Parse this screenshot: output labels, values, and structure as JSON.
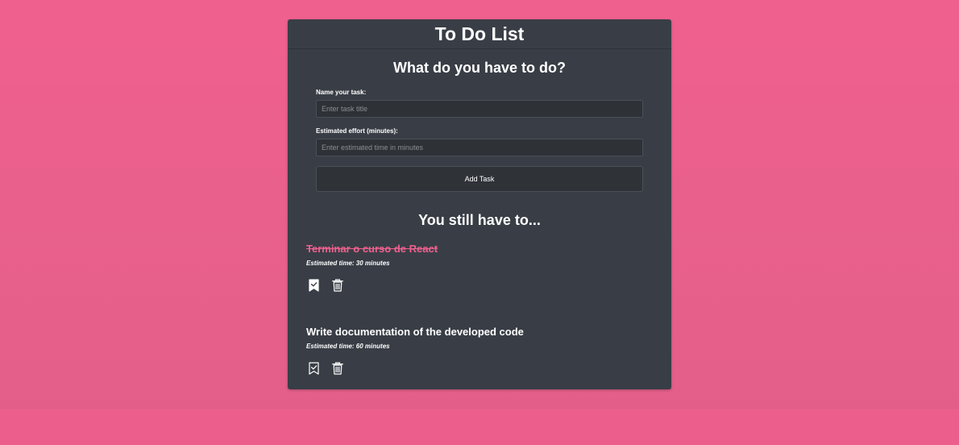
{
  "app": {
    "title": "To Do List"
  },
  "form": {
    "heading": "What do you have to do?",
    "task_label": "Name your task:",
    "task_placeholder": "Enter task title",
    "task_value": "",
    "effort_label": "Estimated effort (minutes):",
    "effort_placeholder": "Enter estimated time in minutes",
    "effort_value": "",
    "submit_label": "Add Task"
  },
  "list": {
    "heading": "You still have to...",
    "tasks": [
      {
        "title": "Terminar o curso de React",
        "estimate": "Estimated time: 30 minutes",
        "completed": true,
        "complete_icon": "bookmark-check-filled-icon",
        "delete_icon": "trash-icon"
      },
      {
        "title": "Write documentation of the developed code",
        "estimate": "Estimated time: 60 minutes",
        "completed": false,
        "complete_icon": "bookmark-check-outline-icon",
        "delete_icon": "trash-icon"
      }
    ]
  },
  "colors": {
    "background": "#f0608f",
    "card": "#393e46",
    "accent": "#f0608f",
    "text": "#ffffff"
  }
}
